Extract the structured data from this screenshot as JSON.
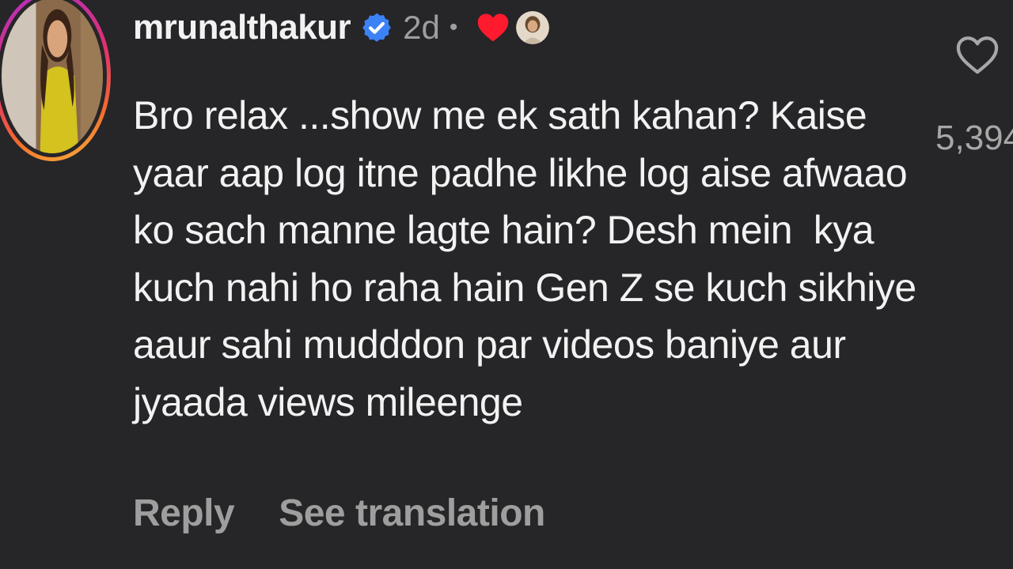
{
  "comment": {
    "username": "mrunalthakur",
    "verified_icon": "verified-badge-icon",
    "time": "2d",
    "separator": "•",
    "reaction_icon": "red-heart-icon",
    "lines": [
      "Bro relax ...show me ek sath kahan? Kaise",
      "yaar aap log itne padhe likhe log aise afwaao",
      "ko sach manne lagte hain? Desh mein  kya",
      "kuch nahi ho raha hain Gen Z se kuch sikhiye",
      "aaur sahi mudddon par videos baniye aur",
      "jyaada views mileenge"
    ],
    "actions": {
      "reply": "Reply",
      "translate": "See translation"
    },
    "likes": {
      "icon": "heart-outline-icon",
      "count": "5,394"
    }
  },
  "colors": {
    "background": "#262528",
    "text": "#f2f2f2",
    "muted": "#9e9e9e",
    "verified": "#3b82f6",
    "heart": "#ff1a2e"
  }
}
